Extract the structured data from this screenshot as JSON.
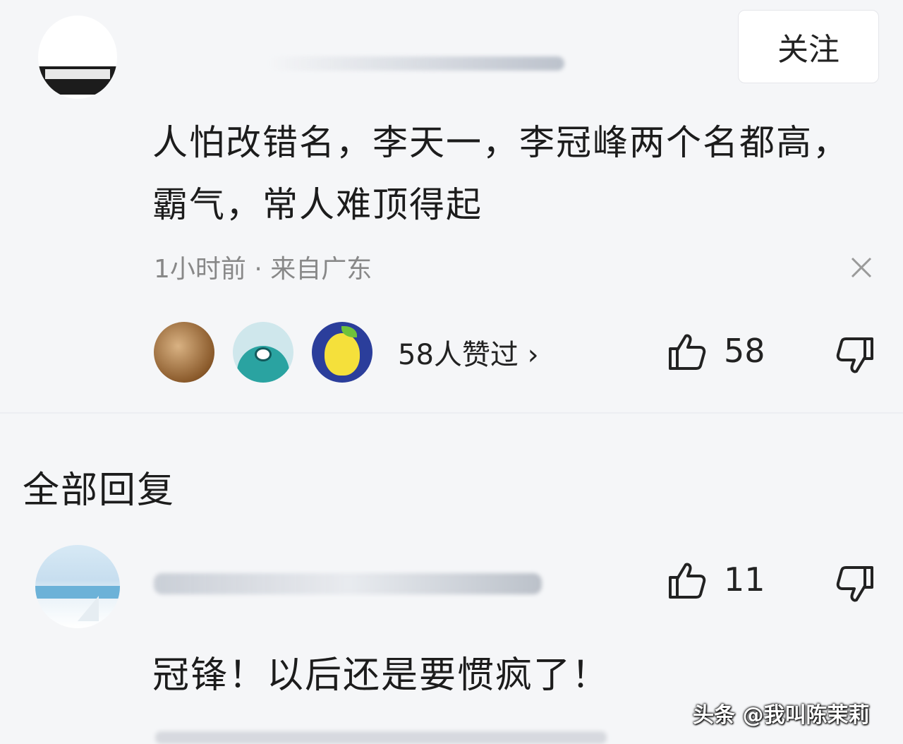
{
  "main_comment": {
    "follow_label": "关注",
    "text": "人怕改错名，李天一，李冠峰两个名都高，霸气，常人难顶得起",
    "meta": "1小时前 · 来自广东",
    "likers_text": "58人赞过 ›",
    "like_count": "58",
    "icons": [
      "close-icon",
      "thumbs-up-icon",
      "thumbs-down-icon"
    ]
  },
  "section_title": "全部回复",
  "reply": {
    "text": "冠锋！以后还是要惯疯了！",
    "like_count": "11",
    "icons": [
      "thumbs-up-icon",
      "thumbs-down-icon"
    ]
  },
  "watermark": "头条 @我叫陈茉莉"
}
